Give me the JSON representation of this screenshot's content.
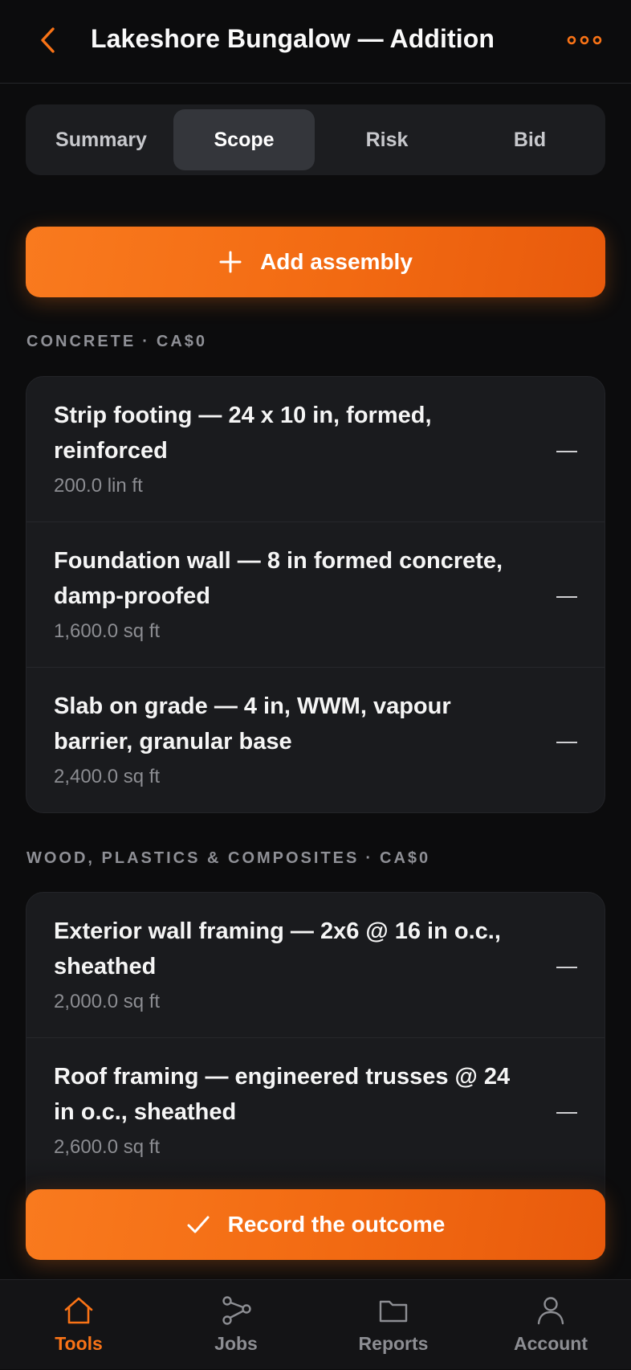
{
  "header": {
    "title": "Lakeshore Bungalow — Addition",
    "back_icon": "chevron-left-icon",
    "more_icon": "more-horizontal-icon",
    "accent": "#f97316"
  },
  "tabs": [
    {
      "label": "Summary",
      "active": false
    },
    {
      "label": "Scope",
      "active": true
    },
    {
      "label": "Risk",
      "active": false
    },
    {
      "label": "Bid",
      "active": false
    }
  ],
  "add_assembly": {
    "label": "Add assembly",
    "icon": "plus-icon"
  },
  "sections": [
    {
      "name": "Concrete",
      "total": "CA$0",
      "items": [
        {
          "name": "Strip footing — 24 x 10 in, formed, reinforced",
          "qty": "200.0 lin ft",
          "value": "—"
        },
        {
          "name": "Foundation wall — 8 in formed concrete, damp-proofed",
          "qty": "1,600.0 sq ft",
          "value": "—"
        },
        {
          "name": "Slab on grade — 4 in, WWM, vapour barrier, granular base",
          "qty": "2,400.0 sq ft",
          "value": "—"
        }
      ]
    },
    {
      "name": "Wood, Plastics & Composites",
      "total": "CA$0",
      "items": [
        {
          "name": "Exterior wall framing — 2x6 @ 16 in o.c., sheathed",
          "qty": "2,000.0 sq ft",
          "value": "—"
        },
        {
          "name": "Roof framing — engineered trusses @ 24 in o.c., sheathed",
          "qty": "2,600.0 sq ft",
          "value": "—"
        }
      ]
    }
  ],
  "record_outcome": {
    "label": "Record the outcome",
    "icon": "check-icon"
  },
  "tabbar": [
    {
      "label": "Tools",
      "icon": "home-icon",
      "active": true
    },
    {
      "label": "Jobs",
      "icon": "share-nodes-icon",
      "active": false
    },
    {
      "label": "Reports",
      "icon": "folder-icon",
      "active": false
    },
    {
      "label": "Account",
      "icon": "user-icon",
      "active": false
    }
  ]
}
